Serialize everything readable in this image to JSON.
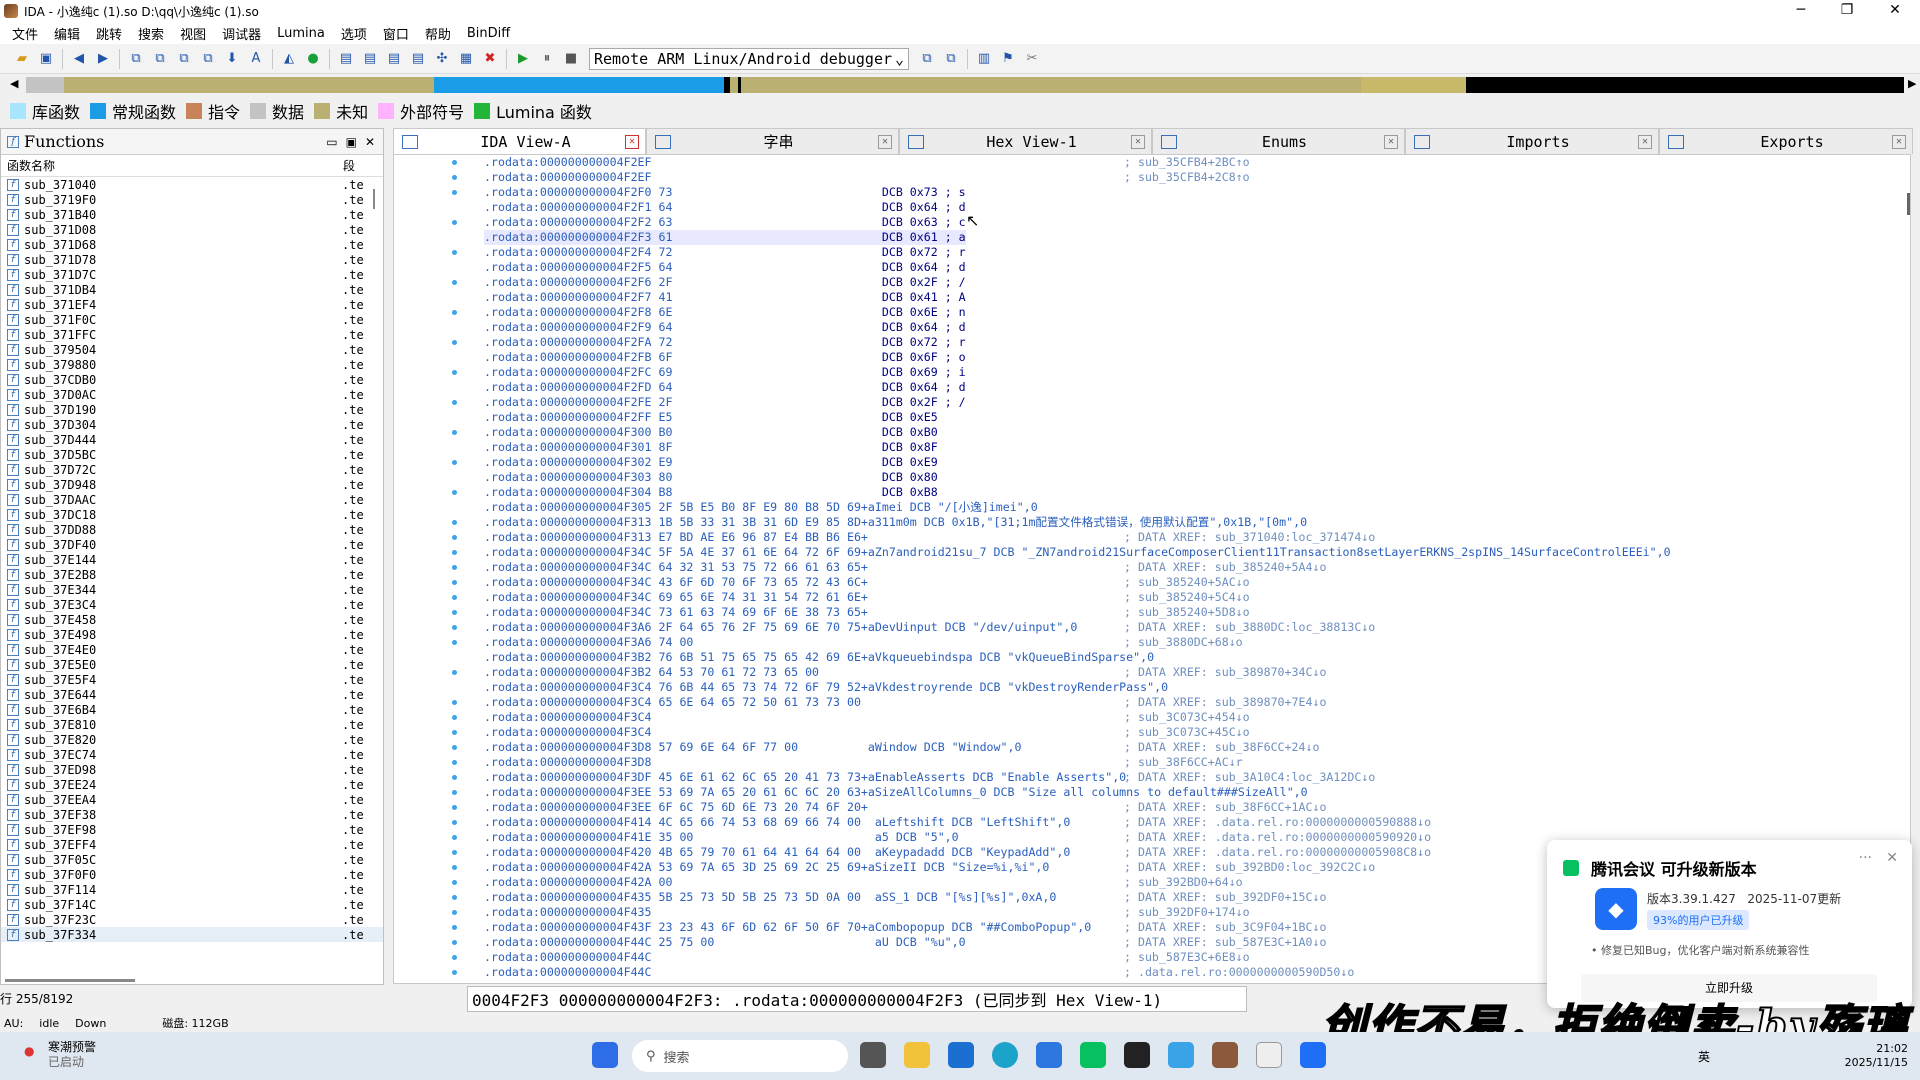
{
  "window": {
    "title": "IDA - 小逸纯c (1).so D:\\qq\\小逸纯c (1).so",
    "min": "─",
    "max": "❐",
    "close": "✕"
  },
  "menu": [
    "文件",
    "编辑",
    "跳转",
    "搜索",
    "视图",
    "调试器",
    "Lumina",
    "选项",
    "窗口",
    "帮助",
    "BinDiff"
  ],
  "toolbar": {
    "debugger": "Remote ARM Linux/Android debugger"
  },
  "legend": [
    {
      "label": "库函数",
      "color": "#a6e6ff"
    },
    {
      "label": "常规函数",
      "color": "#1a9ce6"
    },
    {
      "label": "指令",
      "color": "#c8835a"
    },
    {
      "label": "数据",
      "color": "#c4c4c4"
    },
    {
      "label": "未知",
      "color": "#b9b071"
    },
    {
      "label": "外部符号",
      "color": "#ffb3ff"
    },
    {
      "label": "Lumina 函数",
      "color": "#22b53a"
    }
  ],
  "functions": {
    "title": "Functions",
    "col_name": "函数名称",
    "col_seg": "段",
    "count": "行 255/8192",
    "items": [
      "sub_371040",
      "sub_3719F0",
      "sub_371B40",
      "sub_371D08",
      "sub_371D68",
      "sub_371D78",
      "sub_371D7C",
      "sub_371DB4",
      "sub_371EF4",
      "sub_371F0C",
      "sub_371FFC",
      "sub_379504",
      "sub_379880",
      "sub_37CDB0",
      "sub_37D0AC",
      "sub_37D190",
      "sub_37D304",
      "sub_37D444",
      "sub_37D5BC",
      "sub_37D72C",
      "sub_37D948",
      "sub_37DAAC",
      "sub_37DC18",
      "sub_37DD88",
      "sub_37DF40",
      "sub_37E144",
      "sub_37E2B8",
      "sub_37E344",
      "sub_37E3C4",
      "sub_37E458",
      "sub_37E498",
      "sub_37E4E0",
      "sub_37E5E0",
      "sub_37E5F4",
      "sub_37E644",
      "sub_37E6B4",
      "sub_37E810",
      "sub_37E820",
      "sub_37EC74",
      "sub_37ED98",
      "sub_37EE24",
      "sub_37EEA4",
      "sub_37EF38",
      "sub_37EF98",
      "sub_37EFF4",
      "sub_37F05C",
      "sub_37F0F0",
      "sub_37F114",
      "sub_37F14C",
      "sub_37F23C",
      "sub_37F334"
    ],
    "seg": ".te"
  },
  "tabs": [
    {
      "label": "IDA View-A"
    },
    {
      "label": "字串"
    },
    {
      "label": "Hex View-1"
    },
    {
      "label": "Enums"
    },
    {
      "label": "Imports"
    },
    {
      "label": "Exports"
    }
  ],
  "code": [
    {
      "a": ".rodata:000000000004F2EF",
      "t": "",
      "c": "; sub_35CFB4+2BC↑o"
    },
    {
      "a": ".rodata:000000000004F2EF",
      "t": "",
      "c": "; sub_35CFB4+2C8↑o"
    },
    {
      "a": ".rodata:000000000004F2F0 73",
      "t": "                              DCB 0x73 ; s",
      "c": ""
    },
    {
      "a": ".rodata:000000000004F2F1 64",
      "t": "                              DCB 0x64 ; d",
      "c": ""
    },
    {
      "a": ".rodata:000000000004F2F2 63",
      "t": "                              DCB 0x63 ; c",
      "c": ""
    },
    {
      "a": ".rodata:000000000004F2F3 61",
      "t": "                              DCB 0x61 ; a",
      "c": ""
    },
    {
      "a": ".rodata:000000000004F2F4 72",
      "t": "                              DCB 0x72 ; r",
      "c": ""
    },
    {
      "a": ".rodata:000000000004F2F5 64",
      "t": "                              DCB 0x64 ; d",
      "c": ""
    },
    {
      "a": ".rodata:000000000004F2F6 2F",
      "t": "                              DCB 0x2F ; /",
      "c": ""
    },
    {
      "a": ".rodata:000000000004F2F7 41",
      "t": "                              DCB 0x41 ; A",
      "c": ""
    },
    {
      "a": ".rodata:000000000004F2F8 6E",
      "t": "                              DCB 0x6E ; n",
      "c": ""
    },
    {
      "a": ".rodata:000000000004F2F9 64",
      "t": "                              DCB 0x64 ; d",
      "c": ""
    },
    {
      "a": ".rodata:000000000004F2FA 72",
      "t": "                              DCB 0x72 ; r",
      "c": ""
    },
    {
      "a": ".rodata:000000000004F2FB 6F",
      "t": "                              DCB 0x6F ; o",
      "c": ""
    },
    {
      "a": ".rodata:000000000004F2FC 69",
      "t": "                              DCB 0x69 ; i",
      "c": ""
    },
    {
      "a": ".rodata:000000000004F2FD 64",
      "t": "                              DCB 0x64 ; d",
      "c": ""
    },
    {
      "a": ".rodata:000000000004F2FE 2F",
      "t": "                              DCB 0x2F ; /",
      "c": ""
    },
    {
      "a": ".rodata:000000000004F2FF E5",
      "t": "                              DCB 0xE5",
      "c": ""
    },
    {
      "a": ".rodata:000000000004F300 B0",
      "t": "                              DCB 0xB0",
      "c": ""
    },
    {
      "a": ".rodata:000000000004F301 8F",
      "t": "                              DCB 0x8F",
      "c": ""
    },
    {
      "a": ".rodata:000000000004F302 E9",
      "t": "                              DCB 0xE9",
      "c": ""
    },
    {
      "a": ".rodata:000000000004F303 80",
      "t": "                              DCB 0x80",
      "c": ""
    },
    {
      "a": ".rodata:000000000004F304 B8",
      "t": "                              DCB 0xB8",
      "c": ""
    },
    {
      "a": ".rodata:000000000004F305 2F 5B E5 B0 8F E9 80 B8 5D 69+aImei DCB \"/[小逸]imei\",0",
      "t": "",
      "c": ""
    },
    {
      "a": ".rodata:000000000004F313 1B 5B 33 31 3B 31 6D E9 85 8D+a311m0m DCB 0x1B,\"[31;1m配置文件格式错误，使用默认配置\",0x1B,\"[0m\",0",
      "t": "",
      "c": ""
    },
    {
      "a": ".rodata:000000000004F313 E7 BD AE E6 96 87 E4 BB B6 E6+",
      "t": "",
      "c": "; DATA XREF: sub_371040:loc_371474↓o"
    },
    {
      "a": ".rodata:000000000004F34C 5F 5A 4E 37 61 6E 64 72 6F 69+aZn7android21su_7 DCB \"_ZN7android21SurfaceComposerClient11Transaction8setLayerERKNS_2spINS_14SurfaceControlEEEi\",0",
      "t": "",
      "c": ""
    },
    {
      "a": ".rodata:000000000004F34C 64 32 31 53 75 72 66 61 63 65+",
      "t": "",
      "c": "; DATA XREF: sub_385240+5A4↓o"
    },
    {
      "a": ".rodata:000000000004F34C 43 6F 6D 70 6F 73 65 72 43 6C+",
      "t": "",
      "c": "; sub_385240+5AC↓o"
    },
    {
      "a": ".rodata:000000000004F34C 69 65 6E 74 31 31 54 72 61 6E+",
      "t": "",
      "c": "; sub_385240+5C4↓o"
    },
    {
      "a": ".rodata:000000000004F34C 73 61 63 74 69 6F 6E 38 73 65+",
      "t": "",
      "c": "; sub_385240+5D8↓o"
    },
    {
      "a": ".rodata:000000000004F3A6 2F 64 65 76 2F 75 69 6E 70 75+aDevUinput DCB \"/dev/uinput\",0",
      "t": "",
      "c": "; DATA XREF: sub_3880DC:loc_38813C↓o"
    },
    {
      "a": ".rodata:000000000004F3A6 74 00",
      "t": "",
      "c": "; sub_3880DC+68↓o"
    },
    {
      "a": ".rodata:000000000004F3B2 76 6B 51 75 65 75 65 42 69 6E+aVkqueuebindspa DCB \"vkQueueBindSparse\",0",
      "t": "",
      "c": ""
    },
    {
      "a": ".rodata:000000000004F3B2 64 53 70 61 72 73 65 00",
      "t": "",
      "c": "; DATA XREF: sub_389870+34C↓o"
    },
    {
      "a": ".rodata:000000000004F3C4 76 6B 44 65 73 74 72 6F 79 52+aVkdestroyrende DCB \"vkDestroyRenderPass\",0",
      "t": "",
      "c": ""
    },
    {
      "a": ".rodata:000000000004F3C4 65 6E 64 65 72 50 61 73 73 00",
      "t": "",
      "c": "; DATA XREF: sub_389870+7E4↓o"
    },
    {
      "a": ".rodata:000000000004F3C4",
      "t": "",
      "c": "; sub_3C073C+454↓o"
    },
    {
      "a": ".rodata:000000000004F3C4",
      "t": "",
      "c": "; sub_3C073C+45C↓o"
    },
    {
      "a": ".rodata:000000000004F3D8 57 69 6E 64 6F 77 00          aWindow DCB \"Window\",0",
      "t": "",
      "c": "; DATA XREF: sub_38F6CC+24↓o"
    },
    {
      "a": ".rodata:000000000004F3D8",
      "t": "",
      "c": "; sub_38F6CC+AC↓r"
    },
    {
      "a": ".rodata:000000000004F3DF 45 6E 61 62 6C 65 20 41 73 73+aEnableAsserts DCB \"Enable Asserts\",0",
      "t": "",
      "c": "; DATA XREF: sub_3A10C4:loc_3A12DC↓o"
    },
    {
      "a": ".rodata:000000000004F3EE 53 69 7A 65 20 61 6C 6C 20 63+aSizeAllColumns_0 DCB \"Size all columns to default###SizeAll\",0",
      "t": "",
      "c": ""
    },
    {
      "a": ".rodata:000000000004F3EE 6F 6C 75 6D 6E 73 20 74 6F 20+",
      "t": "",
      "c": "; DATA XREF: sub_38F6CC+1AC↓o"
    },
    {
      "a": ".rodata:000000000004F414 4C 65 66 74 53 68 69 66 74 00  aLeftshift DCB \"LeftShift\",0",
      "t": "",
      "c": "; DATA XREF: .data.rel.ro:0000000000590888↓o"
    },
    {
      "a": ".rodata:000000000004F41E 35 00                          a5 DCB \"5\",0",
      "t": "",
      "c": "; DATA XREF: .data.rel.ro:0000000000590920↓o"
    },
    {
      "a": ".rodata:000000000004F420 4B 65 79 70 61 64 41 64 64 00  aKeypadadd DCB \"KeypadAdd\",0",
      "t": "",
      "c": "; DATA XREF: .data.rel.ro:00000000005908C8↓o"
    },
    {
      "a": ".rodata:000000000004F42A 53 69 7A 65 3D 25 69 2C 25 69+aSizeII DCB \"Size=%i,%i\",0",
      "t": "",
      "c": "; DATA XREF: sub_392BD0:loc_392C2C↓o"
    },
    {
      "a": ".rodata:000000000004F42A 00",
      "t": "",
      "c": "; sub_392BD0+64↓o"
    },
    {
      "a": ".rodata:000000000004F435 5B 25 73 5D 5B 25 73 5D 0A 00  aSS_1 DCB \"[%s][%s]\",0xA,0",
      "t": "",
      "c": "; DATA XREF: sub_392DF0+15C↓o"
    },
    {
      "a": ".rodata:000000000004F435",
      "t": "",
      "c": "; sub_392DF0+174↓o"
    },
    {
      "a": ".rodata:000000000004F43F 23 23 43 6F 6D 62 6F 50 6F 70+aCombopopup DCB \"##ComboPopup\",0",
      "t": "",
      "c": "; DATA XREF: sub_3C9F04+1BC↓o"
    },
    {
      "a": ".rodata:000000000004F44C 25 75 00                       aU DCB \"%u\",0",
      "t": "",
      "c": "; DATA XREF: sub_587E3C+1A0↓o"
    },
    {
      "a": ".rodata:000000000004F44C",
      "t": "",
      "c": "; sub_587E3C+6E8↓o"
    },
    {
      "a": ".rodata:000000000004F44C",
      "t": "",
      "c": "; .data.rel.ro:0000000000590D50↓o"
    }
  ],
  "status": {
    "sync": "0004F2F3 000000000004F2F3: .rodata:000000000004F2F3 (已同步到 Hex View-1)",
    "au": "AU:",
    "idle": "idle",
    "down": "Down",
    "disk": "磁盘: 112GB"
  },
  "popup": {
    "title": "腾讯会议 可升级新版本",
    "version": "版本3.39.1.427",
    "date": "2025-11-07更新",
    "badge": "93%的用户已升级",
    "note": "• 修复已知Bug，优化客户端对新系统兼容性",
    "button": "立即升级",
    "more": "···",
    "close": "✕"
  },
  "watermark": "创作不易，拒绝倒卖-by殇璃",
  "taskbar": {
    "weather_title": "寒潮预警",
    "weather_sub": "已启动",
    "search": "搜索",
    "time": "21:02",
    "date": "2025/11/15",
    "lang": "英"
  }
}
